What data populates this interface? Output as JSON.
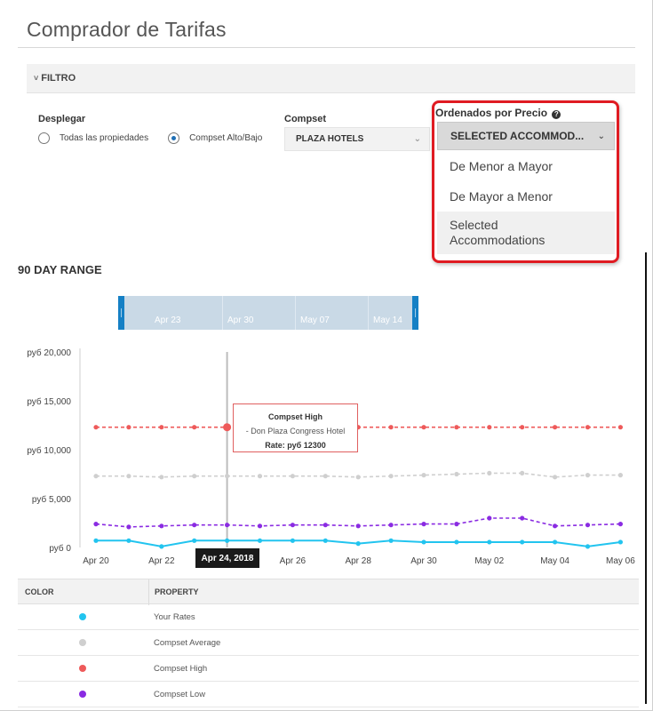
{
  "page": {
    "title": "Comprador de Tarifas"
  },
  "filter": {
    "label": "FILTRO",
    "chevron": "˅"
  },
  "display": {
    "label": "Desplegar",
    "option_all": "Todas las propiedades",
    "option_compset": "Compset Alto/Bajo",
    "selected": "Compset Alto/Bajo"
  },
  "compset": {
    "label": "Compset",
    "value": "PLAZA HOTELS",
    "caret": "⌄"
  },
  "sort": {
    "label": "Ordenados por Precio",
    "help_icon": "?",
    "value": "SELECTED ACCOMMOD...",
    "caret": "⌄",
    "options": [
      "De Menor a Mayor",
      "De Mayor a Menor",
      "Selected Accommodations"
    ],
    "highlight_color": "#e01b22"
  },
  "range": {
    "title": "90 DAY RANGE",
    "navigator_ticks": [
      "Apr 23",
      "Apr 30",
      "May 07",
      "May 14"
    ]
  },
  "chart_data": {
    "type": "line",
    "y_tick_labels": [
      "руб 0",
      "руб 5,000",
      "руб 10,000",
      "руб 15,000",
      "руб 20,000"
    ],
    "ylim": [
      0,
      20000
    ],
    "x_tick_labels": [
      "Apr 20",
      "Apr 22",
      "Apr 24",
      "Apr 26",
      "Apr 28",
      "Apr 30",
      "May 02",
      "May 04",
      "May 06"
    ],
    "x": [
      "Apr 20",
      "Apr 21",
      "Apr 22",
      "Apr 23",
      "Apr 24",
      "Apr 25",
      "Apr 26",
      "Apr 27",
      "Apr 28",
      "Apr 29",
      "Apr 30",
      "May 01",
      "May 02",
      "May 03",
      "May 04",
      "May 05",
      "May 06"
    ],
    "series": [
      {
        "name": "Your Rates",
        "color": "#22c4ef",
        "dashed": false,
        "values": [
          700,
          700,
          100,
          700,
          700,
          700,
          700,
          700,
          400,
          700,
          550,
          550,
          550,
          550,
          550,
          100,
          550
        ]
      },
      {
        "name": "Compset Average",
        "color": "#cfcfcf",
        "dashed": true,
        "values": [
          7300,
          7300,
          7200,
          7300,
          7300,
          7300,
          7300,
          7300,
          7200,
          7300,
          7400,
          7500,
          7600,
          7600,
          7200,
          7400,
          7400
        ]
      },
      {
        "name": "Compset High",
        "color": "#ee5a5a",
        "dashed": true,
        "values": [
          12300,
          12300,
          12300,
          12300,
          12300,
          12300,
          12300,
          12300,
          12300,
          12300,
          12300,
          12300,
          12300,
          12300,
          12300,
          12300,
          12300
        ]
      },
      {
        "name": "Compset Low",
        "color": "#8a2be2",
        "dashed": true,
        "values": [
          2400,
          2100,
          2200,
          2300,
          2300,
          2200,
          2300,
          2300,
          2200,
          2300,
          2400,
          2400,
          3000,
          3000,
          2200,
          2300,
          2400
        ]
      }
    ],
    "tooltip": {
      "title": "Compset High",
      "hotel": "- Don Plaza Congress Hotel",
      "rate": "Rate: руб 12300"
    },
    "crosshair_label": "Apr 24, 2018",
    "crosshair_index": 4,
    "grid": false
  },
  "legend_table": {
    "headers": [
      "COLOR",
      "PROPERTY"
    ],
    "rows": [
      {
        "name": "Your Rates",
        "color": "#22c4ef"
      },
      {
        "name": "Compset Average",
        "color": "#cfcfcf"
      },
      {
        "name": "Compset High",
        "color": "#ee5a5a"
      },
      {
        "name": "Compset Low",
        "color": "#8a2be2"
      }
    ]
  }
}
